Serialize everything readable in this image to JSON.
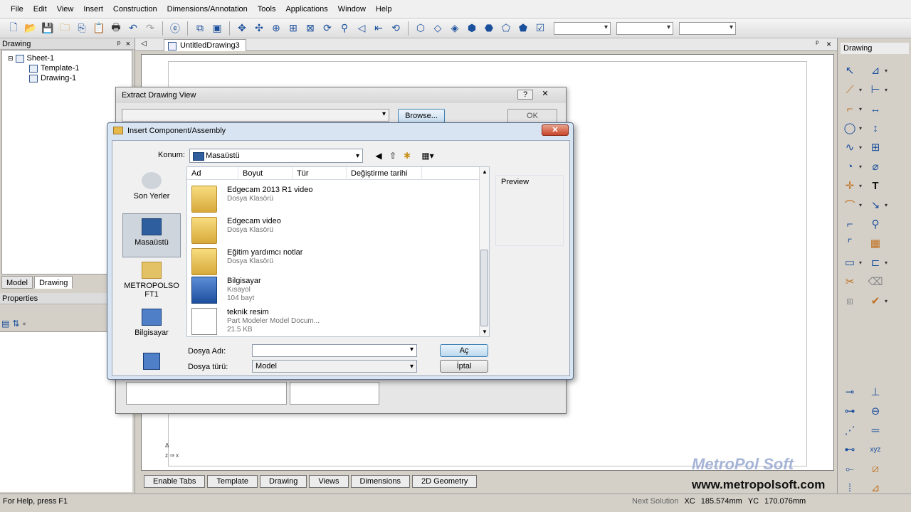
{
  "menubar": [
    "File",
    "Edit",
    "View",
    "Insert",
    "Construction",
    "Dimensions/Annotation",
    "Tools",
    "Applications",
    "Window",
    "Help"
  ],
  "left_panel": {
    "title": "Drawing",
    "pin": "ᵖ",
    "close": "×",
    "tree": [
      "Sheet-1",
      "Template-1",
      "Drawing-1"
    ],
    "tabs": [
      "Model",
      "Drawing"
    ],
    "properties_title": "Properties"
  },
  "document": {
    "tab": "UntitledDrawing3"
  },
  "bottom_tabs": [
    "Enable Tabs",
    "Template",
    "Drawing",
    "Views",
    "Dimensions",
    "2D Geometry"
  ],
  "status": {
    "help": "For Help, press F1",
    "next": "Next Solution",
    "xc_label": "XC",
    "xc": "185.574mm",
    "yc_label": "YC",
    "yc": "170.076mm"
  },
  "right_panel": {
    "title": "Drawing"
  },
  "watermark": "MetroPol Soft",
  "website": "www.metropolsoft.com",
  "extract_dialog": {
    "title": "Extract Drawing View",
    "help": "?",
    "close": "✕",
    "browse": "Browse...",
    "ok": "OK"
  },
  "insert_dialog": {
    "title": "Insert Component/Assembly",
    "close": "✕",
    "konum_label": "Konum:",
    "konum_value": "Masaüstü",
    "places": [
      "Son Yerler",
      "Masaüstü",
      "METROPOLSOFT1",
      "Bilgisayar"
    ],
    "columns": [
      "Ad",
      "Boyut",
      "Tür",
      "Değiştirme tarihi"
    ],
    "files": [
      {
        "name": "Edgecam 2013 R1 video",
        "type": "Dosya Klasörü",
        "size": ""
      },
      {
        "name": "Edgecam video",
        "type": "Dosya Klasörü",
        "size": ""
      },
      {
        "name": "Eğitim yardımcı notlar",
        "type": "Dosya Klasörü",
        "size": ""
      },
      {
        "name": "Bilgisayar",
        "type": "Kısayol",
        "size": "104 bayt"
      },
      {
        "name": "teknik resim",
        "type": "Part Modeler Model Docum...",
        "size": "21.5 KB"
      }
    ],
    "preview": "Preview",
    "dosya_adi_label": "Dosya Adı:",
    "dosya_adi_value": "",
    "dosya_turu_label": "Dosya türü:",
    "dosya_turu_value": "Model",
    "open": "Aç",
    "cancel": "İptal"
  }
}
